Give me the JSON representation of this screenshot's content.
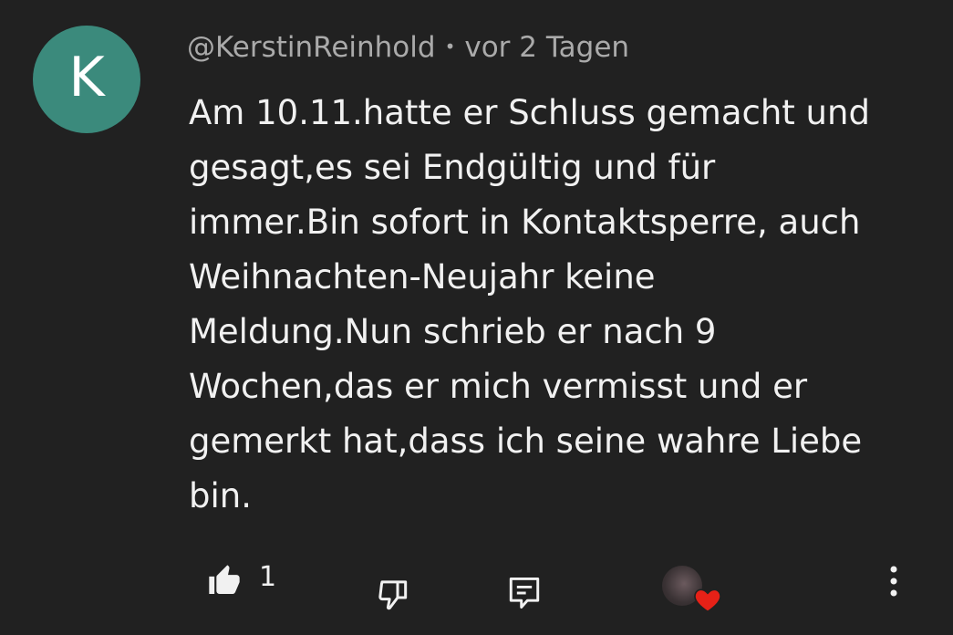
{
  "comment": {
    "avatar_letter": "K",
    "avatar_color": "#3b8a7c",
    "username": "@KerstinReinhold",
    "separator": "•",
    "timestamp": "vor 2 Tagen",
    "text": "Am 10.11.hatte er Schluss gemacht und\ngesagt,es sei Endgültig und für\nimmer.Bin sofort in Kontaktsperre, auch\nWeihnachten-Neujahr keine\nMeldung.Nun schrieb er nach 9\nWochen,das er mich vermisst und er\ngemerkt hat,dass ich seine wahre Liebe\nbin."
  },
  "actions": {
    "like_count": "1",
    "like_icon": "thumbs-up-icon",
    "dislike_icon": "thumbs-down-icon",
    "reply_icon": "reply-icon",
    "creator_heart_icon": "creator-heart-icon",
    "more_icon": "more-vertical-icon",
    "heart_color": "#e62117"
  }
}
